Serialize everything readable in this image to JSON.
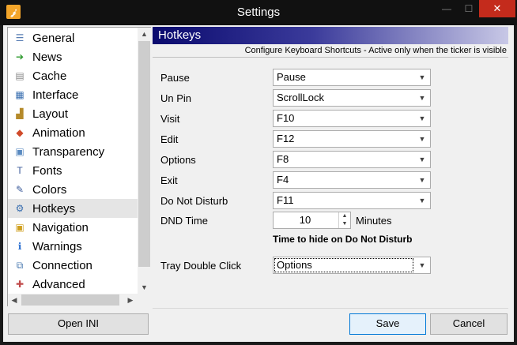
{
  "window": {
    "title": "Settings",
    "app_icon_glyph": "𝒿",
    "close_glyph": "✕",
    "min_glyph": "—",
    "max_glyph": "☐"
  },
  "sidebar": {
    "items": [
      {
        "label": "General",
        "icon": "general-icon",
        "glyph": "☰",
        "color": "#5a7fb5"
      },
      {
        "label": "News",
        "icon": "news-arrow-icon",
        "glyph": "➔",
        "color": "#2e9a2e"
      },
      {
        "label": "Cache",
        "icon": "cache-icon",
        "glyph": "▤",
        "color": "#8a8a8a"
      },
      {
        "label": "Interface",
        "icon": "interface-icon",
        "glyph": "▦",
        "color": "#3a6fb0"
      },
      {
        "label": "Layout",
        "icon": "layout-icon",
        "glyph": "▟",
        "color": "#b58a2a"
      },
      {
        "label": "Animation",
        "icon": "animation-icon",
        "glyph": "◆",
        "color": "#d04a2a"
      },
      {
        "label": "Transparency",
        "icon": "transparency-icon",
        "glyph": "▣",
        "color": "#5a8ac0"
      },
      {
        "label": "Fonts",
        "icon": "fonts-icon",
        "glyph": "T",
        "color": "#3a5a9a"
      },
      {
        "label": "Colors",
        "icon": "colors-icon",
        "glyph": "✎",
        "color": "#3a5a9a"
      },
      {
        "label": "Hotkeys",
        "icon": "hotkeys-icon",
        "glyph": "⚙",
        "color": "#3a6fb0"
      },
      {
        "label": "Navigation",
        "icon": "navigation-icon",
        "glyph": "▣",
        "color": "#d0a020"
      },
      {
        "label": "Warnings",
        "icon": "warnings-icon",
        "glyph": "ℹ",
        "color": "#2a6fd0"
      },
      {
        "label": "Connection",
        "icon": "connection-icon",
        "glyph": "⧉",
        "color": "#4a7ab0"
      },
      {
        "label": "Advanced",
        "icon": "advanced-icon",
        "glyph": "✚",
        "color": "#c04a4a"
      }
    ],
    "selected": "Hotkeys"
  },
  "buttons": {
    "open_ini": "Open INI",
    "save": "Save",
    "cancel": "Cancel"
  },
  "panel": {
    "header": "Hotkeys",
    "subtitle": "Configure Keyboard Shortcuts - Active only when the ticker is visible",
    "rows": [
      {
        "label": "Pause",
        "value": "Pause"
      },
      {
        "label": "Un Pin",
        "value": "ScrollLock"
      },
      {
        "label": "Visit",
        "value": "F10"
      },
      {
        "label": "Edit",
        "value": "F12"
      },
      {
        "label": "Options",
        "value": "F8"
      },
      {
        "label": "Exit",
        "value": "F4"
      },
      {
        "label": "Do Not Disturb",
        "value": "F11"
      }
    ],
    "dnd_time": {
      "label": "DND Time",
      "value": "10",
      "unit": "Minutes",
      "note": "Time to hide on Do Not Disturb"
    },
    "tray": {
      "label": "Tray Double Click",
      "value": "Options"
    }
  }
}
